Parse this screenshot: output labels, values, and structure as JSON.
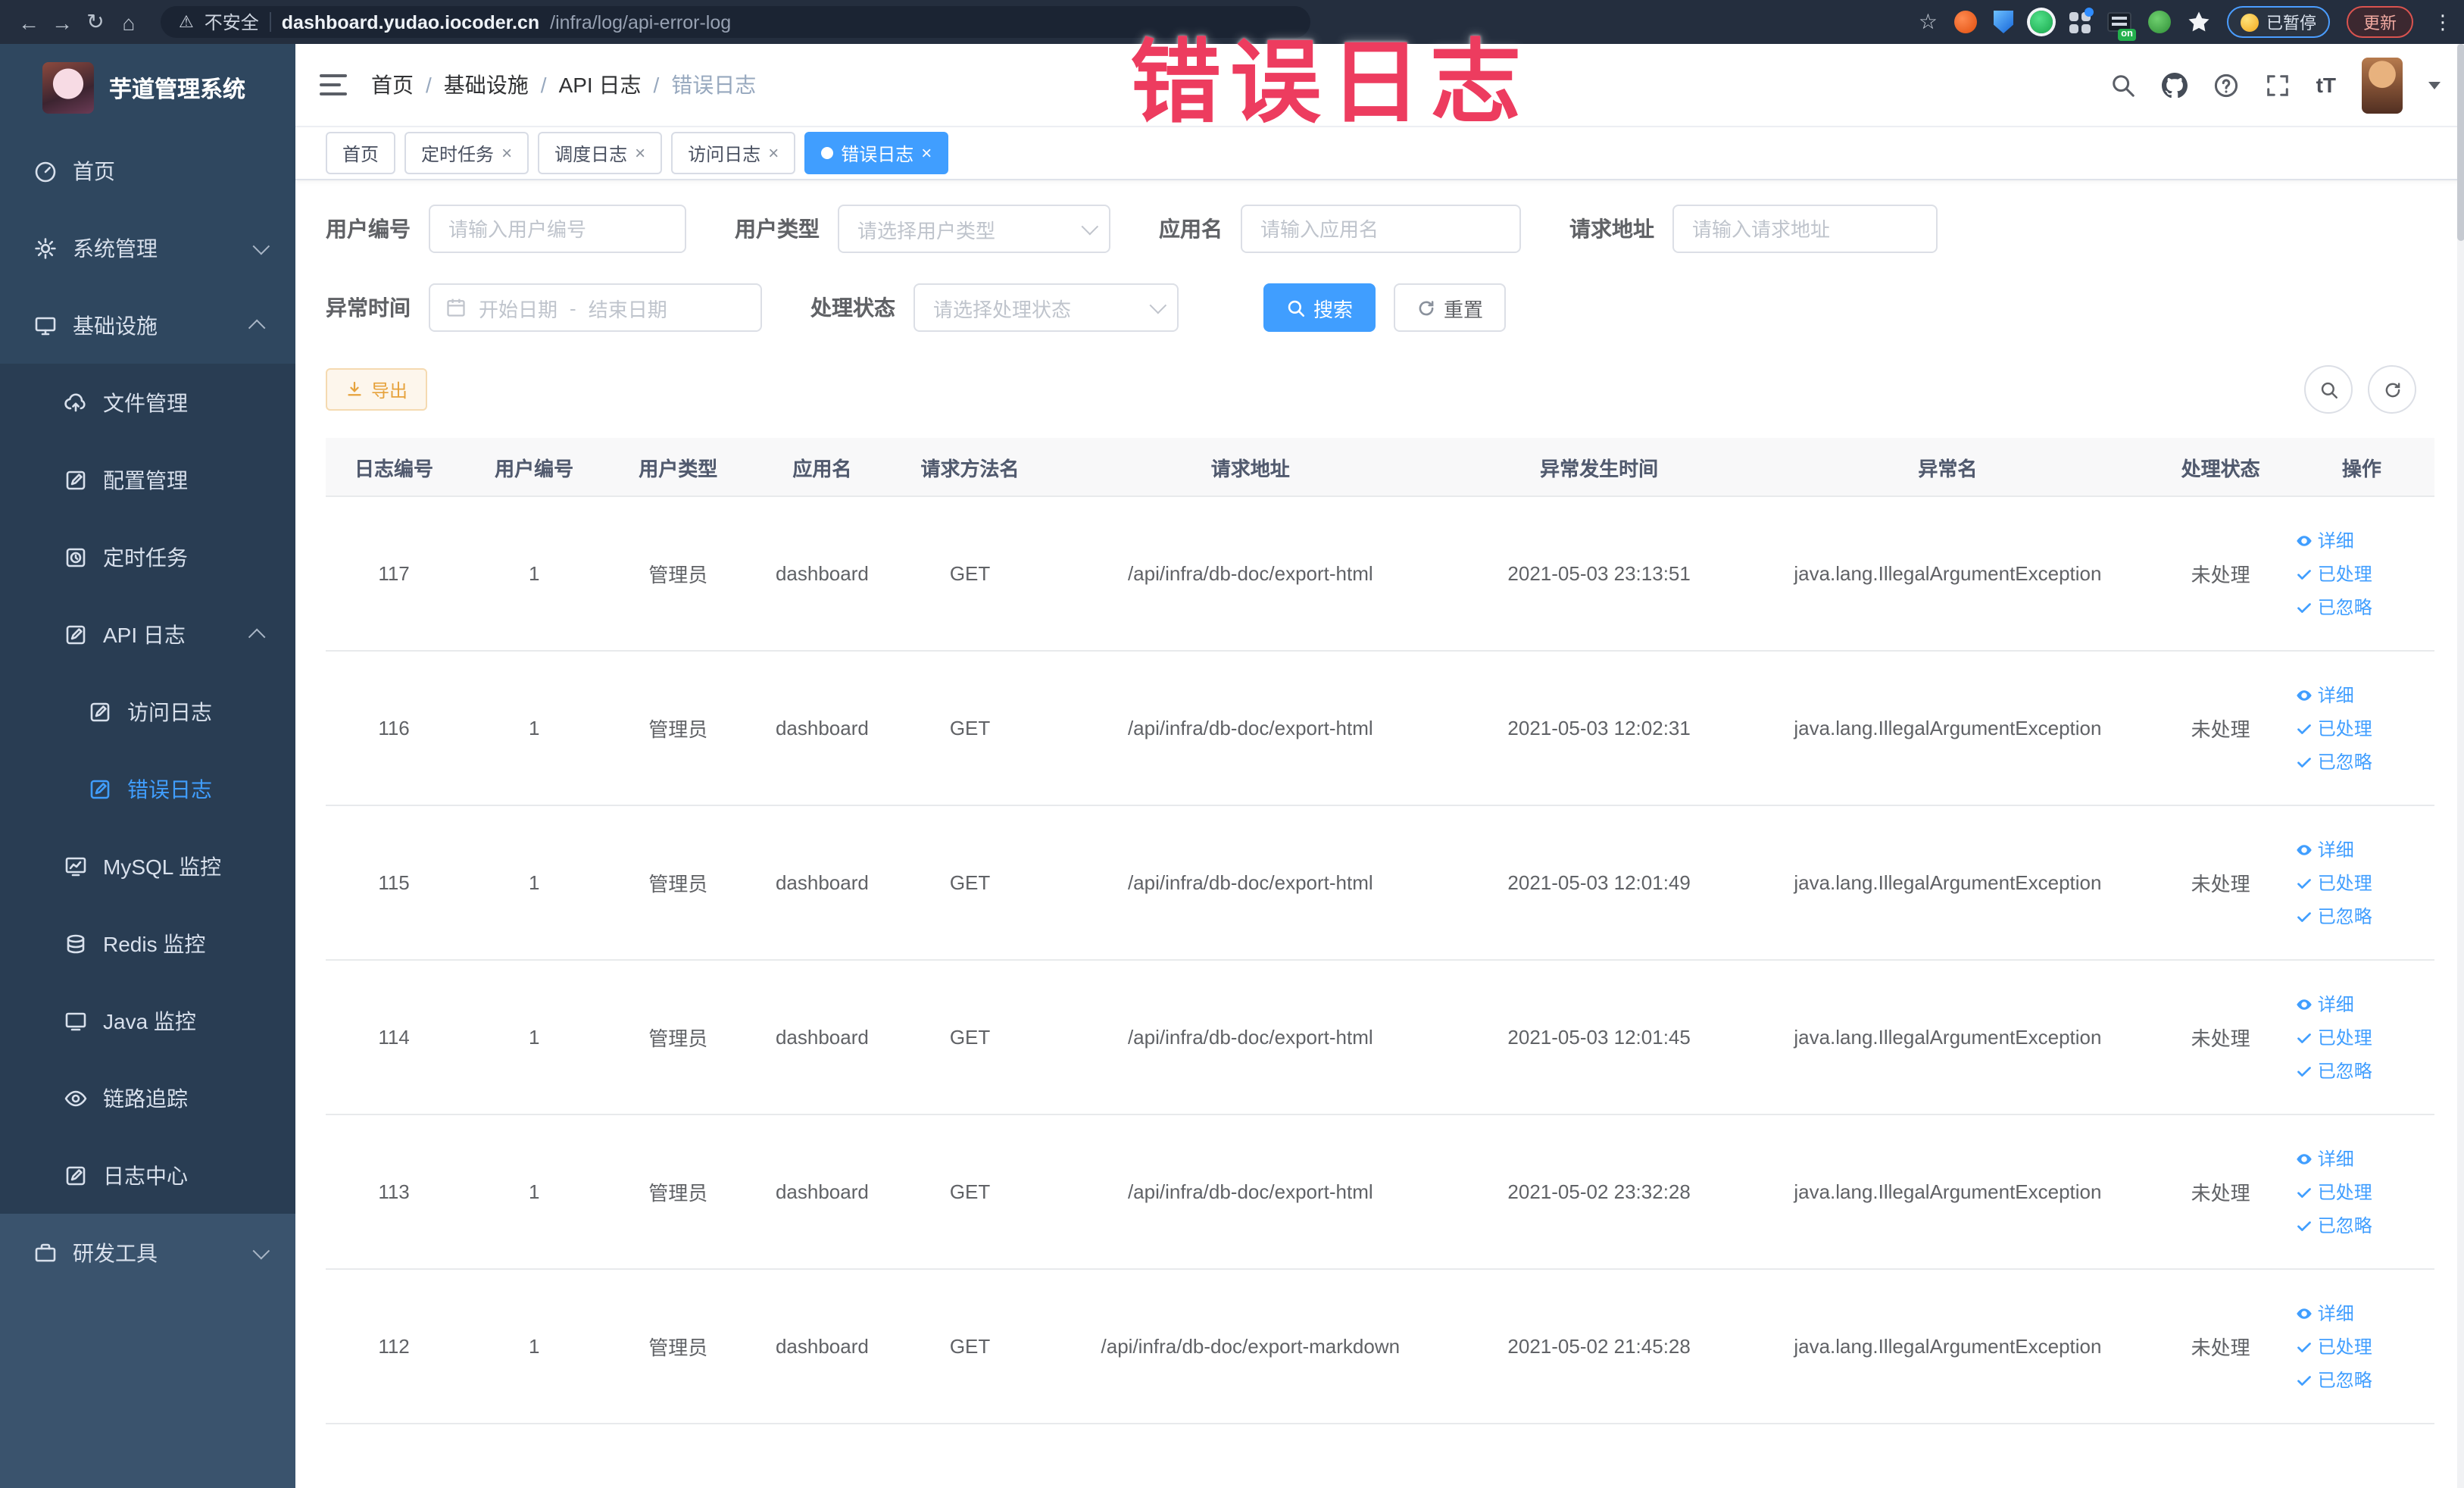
{
  "overlay": {
    "text": "错误日志"
  },
  "browser": {
    "back_glyph": "←",
    "forward_glyph": "→",
    "reload_glyph": "↻",
    "home_glyph": "⌂",
    "warning_glyph": "⚠",
    "security_label": "不安全",
    "url_host": "dashboard.yudao.iocoder.cn",
    "url_path": "/infra/log/api-error-log",
    "bookmark_glyph": "☆",
    "ext_on_badge": "on",
    "paused_label": "已暂停",
    "update_label": "更新",
    "kebab_glyph": "⋮"
  },
  "sidebar": {
    "title": "芋道管理系统",
    "items": [
      {
        "label": "首页",
        "icon": "dashboard-icon"
      },
      {
        "label": "系统管理",
        "icon": "gear-icon"
      },
      {
        "label": "基础设施",
        "icon": "monitor-icon"
      },
      {
        "label": "文件管理",
        "icon": "cloud-upload-icon"
      },
      {
        "label": "配置管理",
        "icon": "edit-icon"
      },
      {
        "label": "定时任务",
        "icon": "timer-icon"
      },
      {
        "label": "API 日志",
        "icon": "edit-icon"
      },
      {
        "label": "访问日志",
        "icon": "edit-icon"
      },
      {
        "label": "错误日志",
        "icon": "edit-icon"
      },
      {
        "label": "MySQL 监控",
        "icon": "chart-icon"
      },
      {
        "label": "Redis 监控",
        "icon": "stack-icon"
      },
      {
        "label": "Java 监控",
        "icon": "desktop-icon"
      },
      {
        "label": "链路追踪",
        "icon": "eye-icon"
      },
      {
        "label": "日志中心",
        "icon": "edit-icon"
      },
      {
        "label": "研发工具",
        "icon": "toolbox-icon"
      }
    ]
  },
  "navbar": {
    "breadcrumb": [
      "首页",
      "基础设施",
      "API 日志",
      "错误日志"
    ],
    "separator": "/",
    "font_size_glyph": "tT"
  },
  "tabs": {
    "close_glyph": "×",
    "items": [
      {
        "label": "首页"
      },
      {
        "label": "定时任务"
      },
      {
        "label": "调度日志"
      },
      {
        "label": "访问日志"
      },
      {
        "label": "错误日志"
      }
    ]
  },
  "filters": {
    "user_id_label": "用户编号",
    "user_id_placeholder": "请输入用户编号",
    "user_type_label": "用户类型",
    "user_type_placeholder": "请选择用户类型",
    "app_name_label": "应用名",
    "app_name_placeholder": "请输入应用名",
    "request_url_label": "请求地址",
    "request_url_placeholder": "请输入请求地址",
    "exception_time_label": "异常时间",
    "date_start_placeholder": "开始日期",
    "date_separator": "-",
    "date_end_placeholder": "结束日期",
    "process_status_label": "处理状态",
    "process_status_placeholder": "请选择处理状态",
    "search_label": "搜索",
    "reset_label": "重置"
  },
  "toolbar": {
    "export_label": "导出"
  },
  "table": {
    "columns": [
      "日志编号",
      "用户编号",
      "用户类型",
      "应用名",
      "请求方法名",
      "请求地址",
      "异常发生时间",
      "异常名",
      "处理状态",
      "操作"
    ],
    "action_labels": {
      "detail": "详细",
      "processed": "已处理",
      "ignored": "已忽略"
    },
    "rows": [
      {
        "id": "117",
        "user_id": "1",
        "user_type": "管理员",
        "app": "dashboard",
        "method": "GET",
        "url": "/api/infra/db-doc/export-html",
        "time": "2021-05-03 23:13:51",
        "exception": "java.lang.IllegalArgumentException",
        "status": "未处理"
      },
      {
        "id": "116",
        "user_id": "1",
        "user_type": "管理员",
        "app": "dashboard",
        "method": "GET",
        "url": "/api/infra/db-doc/export-html",
        "time": "2021-05-03 12:02:31",
        "exception": "java.lang.IllegalArgumentException",
        "status": "未处理"
      },
      {
        "id": "115",
        "user_id": "1",
        "user_type": "管理员",
        "app": "dashboard",
        "method": "GET",
        "url": "/api/infra/db-doc/export-html",
        "time": "2021-05-03 12:01:49",
        "exception": "java.lang.IllegalArgumentException",
        "status": "未处理"
      },
      {
        "id": "114",
        "user_id": "1",
        "user_type": "管理员",
        "app": "dashboard",
        "method": "GET",
        "url": "/api/infra/db-doc/export-html",
        "time": "2021-05-03 12:01:45",
        "exception": "java.lang.IllegalArgumentException",
        "status": "未处理"
      },
      {
        "id": "113",
        "user_id": "1",
        "user_type": "管理员",
        "app": "dashboard",
        "method": "GET",
        "url": "/api/infra/db-doc/export-html",
        "time": "2021-05-02 23:32:28",
        "exception": "java.lang.IllegalArgumentException",
        "status": "未处理"
      },
      {
        "id": "112",
        "user_id": "1",
        "user_type": "管理员",
        "app": "dashboard",
        "method": "GET",
        "url": "/api/infra/db-doc/export-markdown",
        "time": "2021-05-02 21:45:28",
        "exception": "java.lang.IllegalArgumentException",
        "status": "未处理"
      }
    ]
  }
}
